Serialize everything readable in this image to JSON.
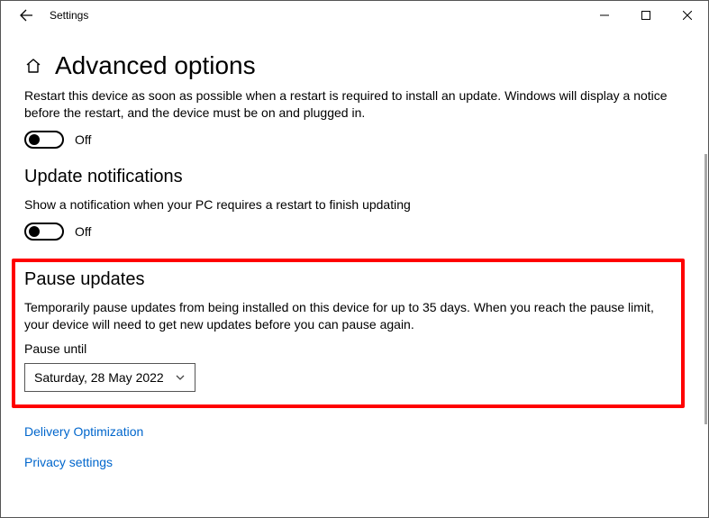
{
  "titlebar": {
    "app_title": "Settings"
  },
  "page": {
    "title": "Advanced options",
    "restart_desc": "Restart this device as soon as possible when a restart is required to install an update. Windows will display a notice before the restart, and the device must be on and plugged in."
  },
  "restart_toggle": {
    "label": "Off"
  },
  "notifications": {
    "header": "Update notifications",
    "desc": "Show a notification when your PC requires a restart to finish updating",
    "toggle_label": "Off"
  },
  "pause": {
    "header": "Pause updates",
    "desc": "Temporarily pause updates from being installed on this device for up to 35 days. When you reach the pause limit, your device will need to get new updates before you can pause again.",
    "label": "Pause until",
    "selected": "Saturday, 28 May 2022"
  },
  "links": {
    "delivery": "Delivery Optimization",
    "privacy": "Privacy settings"
  }
}
